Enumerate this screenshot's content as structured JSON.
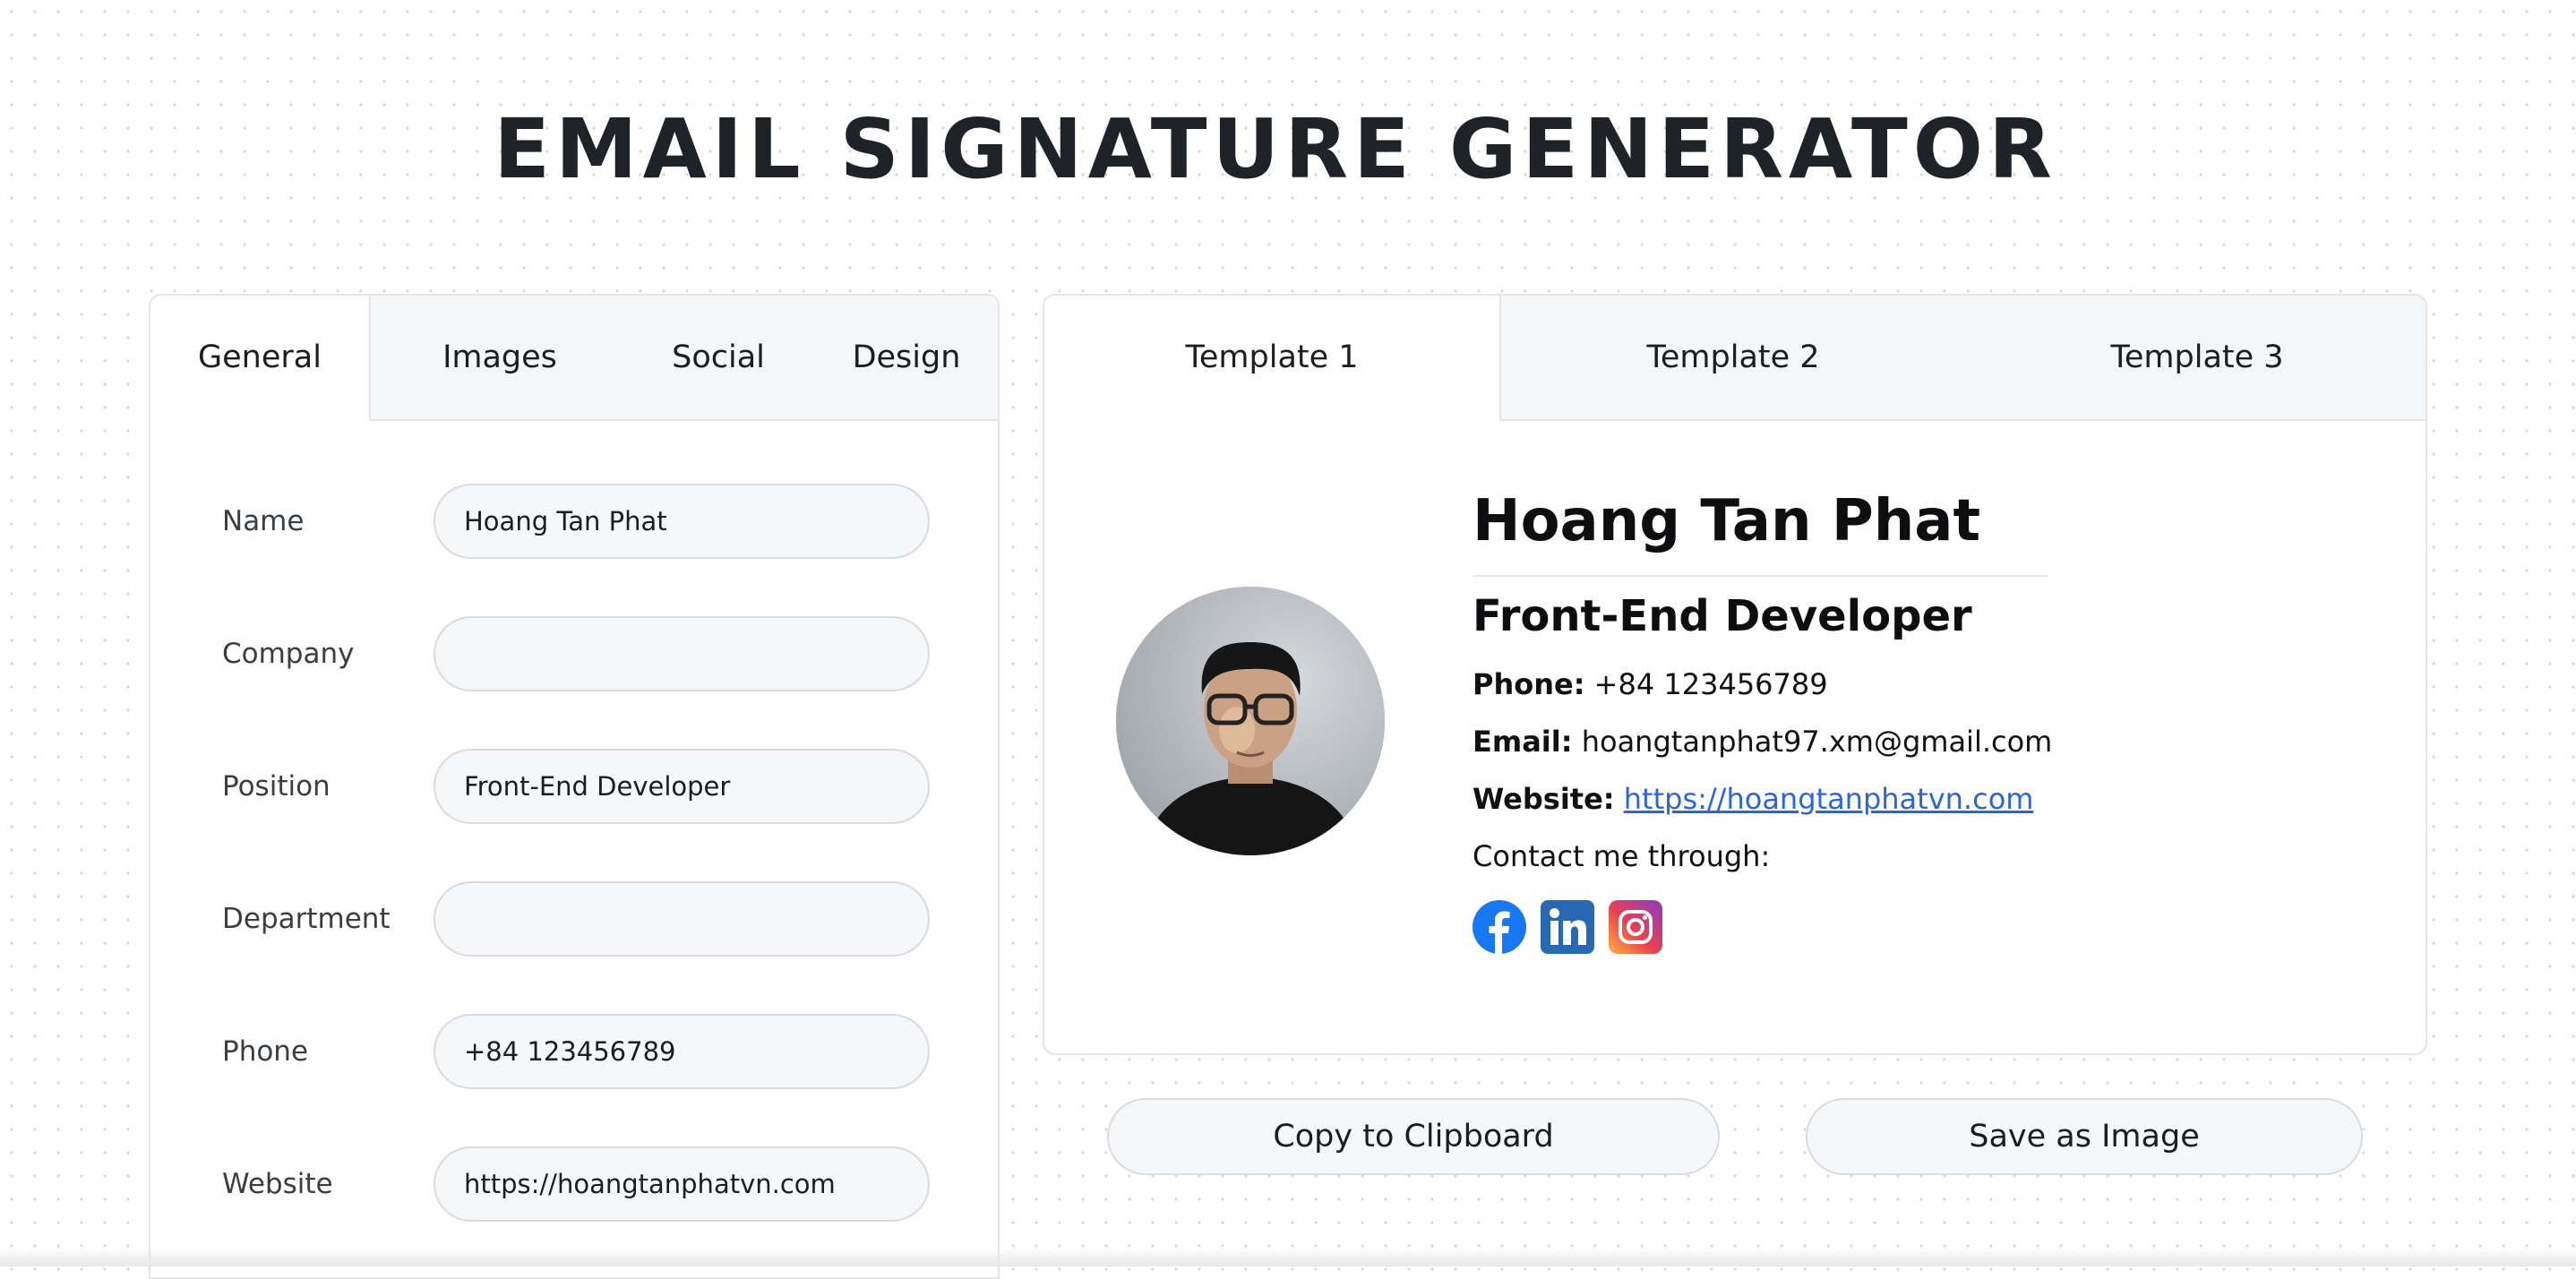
{
  "page": {
    "title": "EMAIL SIGNATURE GENERATOR"
  },
  "editor": {
    "tabs": [
      {
        "label": "General",
        "active": true
      },
      {
        "label": "Images",
        "active": false
      },
      {
        "label": "Social",
        "active": false
      },
      {
        "label": "Design",
        "active": false
      }
    ],
    "fields": [
      {
        "label": "Name",
        "value": "Hoang Tan Phat"
      },
      {
        "label": "Company",
        "value": ""
      },
      {
        "label": "Position",
        "value": "Front-End Developer"
      },
      {
        "label": "Department",
        "value": ""
      },
      {
        "label": "Phone",
        "value": "+84 123456789"
      },
      {
        "label": "Website",
        "value": "https://hoangtanphatvn.com"
      }
    ]
  },
  "preview": {
    "tabs": [
      {
        "label": "Template 1",
        "active": true
      },
      {
        "label": "Template 2",
        "active": false
      },
      {
        "label": "Template 3",
        "active": false
      }
    ],
    "signature": {
      "name": "Hoang Tan Phat",
      "position": "Front-End Developer",
      "phone_label": "Phone:",
      "phone": "+84 123456789",
      "email_label": "Email:",
      "email": "hoangtanphat97.xm@gmail.com",
      "website_label": "Website:",
      "website": "https://hoangtanphatvn.com",
      "contact_text": "Contact me through:",
      "social_icons": [
        "facebook-icon",
        "linkedin-icon",
        "instagram-icon"
      ]
    }
  },
  "actions": {
    "copy_label": "Copy to Clipboard",
    "save_label": "Save as Image"
  },
  "colors": {
    "link": "#2a66d8",
    "facebook": "#1877f2",
    "linkedin": "#2867b2",
    "panel_border": "#e3e5e8",
    "tab_bg": "#f5f6f7"
  }
}
